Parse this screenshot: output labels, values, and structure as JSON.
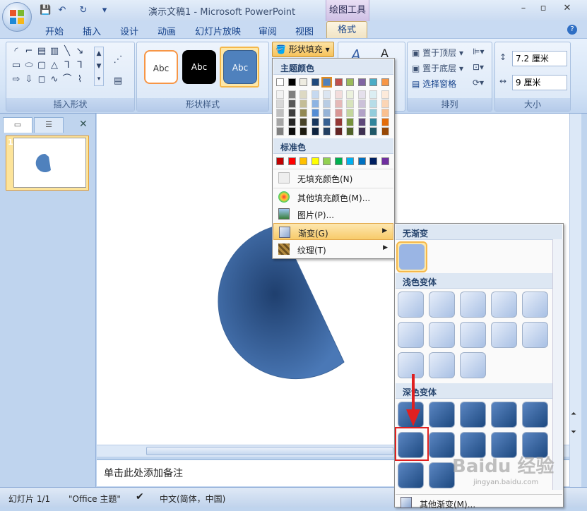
{
  "window": {
    "title": "演示文稿1 - Microsoft PowerPoint",
    "context_tab_group": "绘图工具"
  },
  "tabs": [
    "开始",
    "插入",
    "设计",
    "动画",
    "幻灯片放映",
    "审阅",
    "视图",
    "格式"
  ],
  "ribbon": {
    "groups": {
      "insert_shapes": "插入形状",
      "shape_styles": "形状样式",
      "arrange": "排列",
      "size": "大小"
    },
    "style_sample": "Abc",
    "shape_fill_button": "形状填充",
    "arrange": {
      "bring_to_front": "置于顶层",
      "send_to_back": "置于底层",
      "selection_pane": "选择窗格"
    },
    "size": {
      "height": "7.2 厘米",
      "width": "9 厘米"
    }
  },
  "fill_menu": {
    "theme_colors_header": "主题颜色",
    "standard_colors_header": "标准色",
    "no_fill": "无填充颜色(N)",
    "more_colors": "其他填充颜色(M)...",
    "picture": "图片(P)...",
    "gradient": "渐变(G)",
    "texture": "纹理(T)",
    "theme_top": [
      "#ffffff",
      "#000000",
      "#eeece1",
      "#1f497d",
      "#4f81bd",
      "#c0504d",
      "#9bbb59",
      "#8064a2",
      "#4bacc6",
      "#f79646"
    ],
    "theme_shades": [
      [
        "#f2f2f2",
        "#7f7f7f",
        "#ddd9c3",
        "#c6d9f0",
        "#dbe5f1",
        "#f2dcdb",
        "#ebf1dd",
        "#e5e0ec",
        "#dbeef3",
        "#fdeada"
      ],
      [
        "#d8d8d8",
        "#595959",
        "#c4bd97",
        "#8db3e2",
        "#b8cce4",
        "#e5b9b7",
        "#d7e3bc",
        "#ccc1d9",
        "#b7dde8",
        "#fbd5b5"
      ],
      [
        "#bfbfbf",
        "#3f3f3f",
        "#938953",
        "#548dd4",
        "#95b3d7",
        "#d99694",
        "#c3d69b",
        "#b2a2c7",
        "#92cddc",
        "#fac08f"
      ],
      [
        "#a5a5a5",
        "#262626",
        "#494429",
        "#17365d",
        "#366092",
        "#953734",
        "#76923c",
        "#5f497a",
        "#31859b",
        "#e36c09"
      ],
      [
        "#7f7f7f",
        "#0c0c0c",
        "#1d1b10",
        "#0f243e",
        "#244061",
        "#632423",
        "#4f6128",
        "#3f3151",
        "#205867",
        "#974806"
      ]
    ],
    "standard": [
      "#c00000",
      "#ff0000",
      "#ffc000",
      "#ffff00",
      "#92d050",
      "#00b050",
      "#00b0f0",
      "#0070c0",
      "#002060",
      "#7030a0"
    ]
  },
  "gradient_menu": {
    "no_gradient": "无渐变",
    "light_variants": "浅色变体",
    "dark_variants": "深色变体",
    "more_gradients": "其他渐变(M)..."
  },
  "notes_placeholder": "单击此处添加备注",
  "slide_number": "1",
  "status": {
    "slide": "幻灯片 1/1",
    "theme": "\"Office 主题\"",
    "language": "中文(简体，中国)"
  },
  "watermark": "Baidu 经验",
  "watermark_sub": "jingyan.baidu.com"
}
